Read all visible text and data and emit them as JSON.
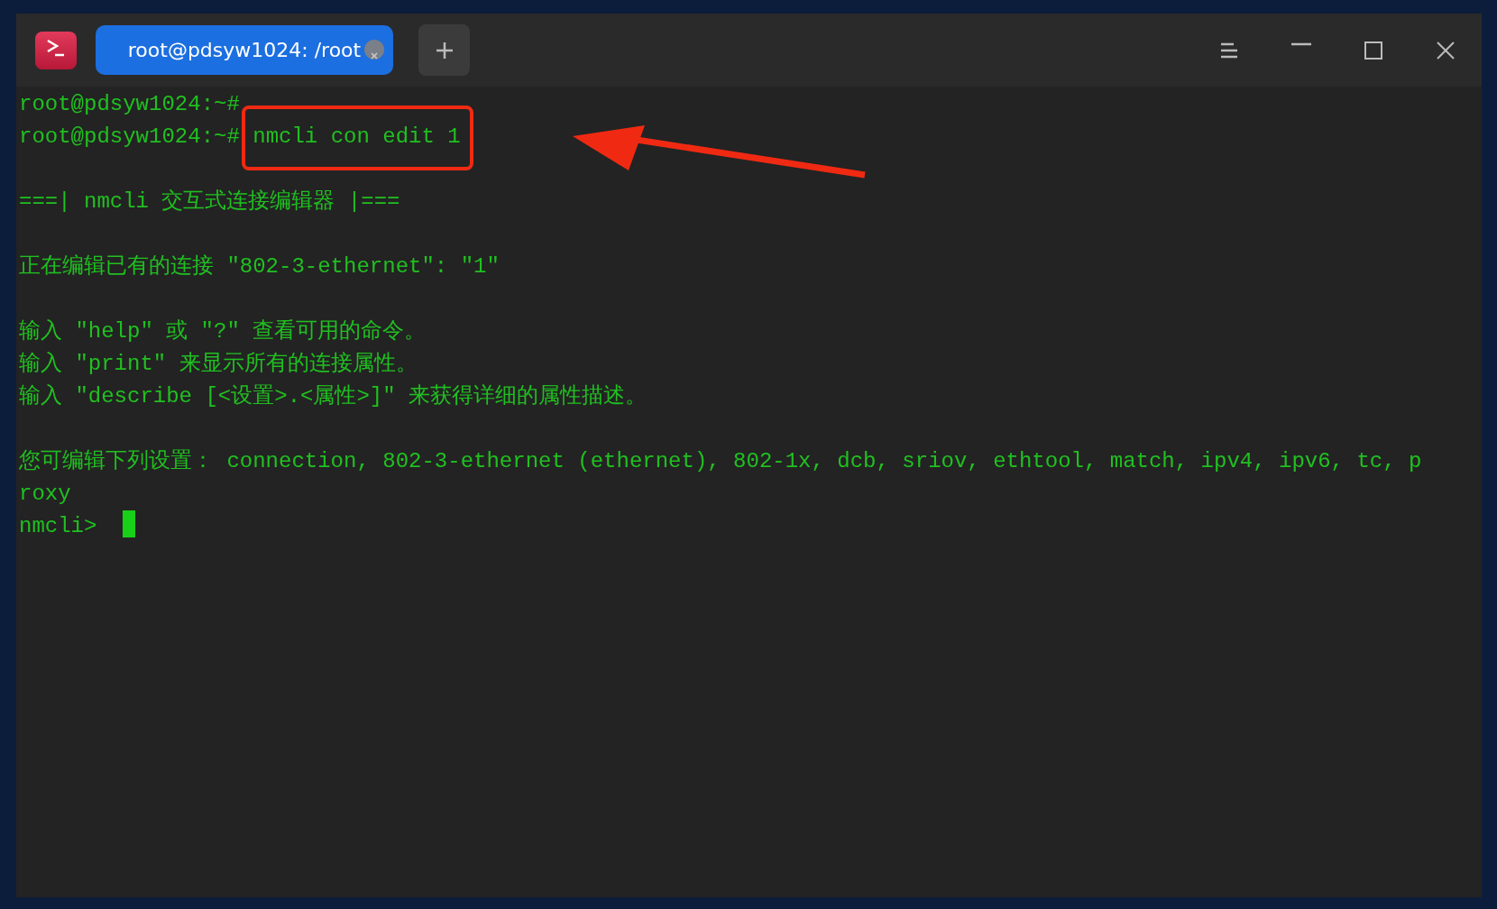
{
  "window": {
    "tabs": [
      {
        "label": "root@pdsyw1024: /root",
        "selected": true
      }
    ]
  },
  "terminal": {
    "lines": [
      {
        "kind": "prompt",
        "prompt": "root@pdsyw1024:~#"
      },
      {
        "kind": "prompt",
        "prompt": "root@pdsyw1024:~#",
        "command": "nmcli con edit 1",
        "highlighted": true
      },
      {
        "kind": "blank"
      },
      {
        "kind": "output",
        "text": "===| nmcli 交互式连接编辑器 |==="
      },
      {
        "kind": "blank"
      },
      {
        "kind": "output",
        "text": "正在编辑已有的连接 \"802-3-ethernet\": \"1\""
      },
      {
        "kind": "blank"
      },
      {
        "kind": "output",
        "text": "输入 \"help\" 或 \"?\" 查看可用的命令。"
      },
      {
        "kind": "output",
        "text": "输入 \"print\" 来显示所有的连接属性。"
      },
      {
        "kind": "output",
        "text": "输入 \"describe [<设置>.<属性>]\" 来获得详细的属性描述。"
      },
      {
        "kind": "blank"
      },
      {
        "kind": "output",
        "text": "您可编辑下列设置： connection, 802-3-ethernet (ethernet), 802-1x, dcb, sriov, ethtool, match, ipv4, ipv6, tc, p"
      },
      {
        "kind": "output",
        "text": "roxy"
      },
      {
        "kind": "prompt",
        "prompt": "nmcli>",
        "cursor": true
      }
    ]
  }
}
